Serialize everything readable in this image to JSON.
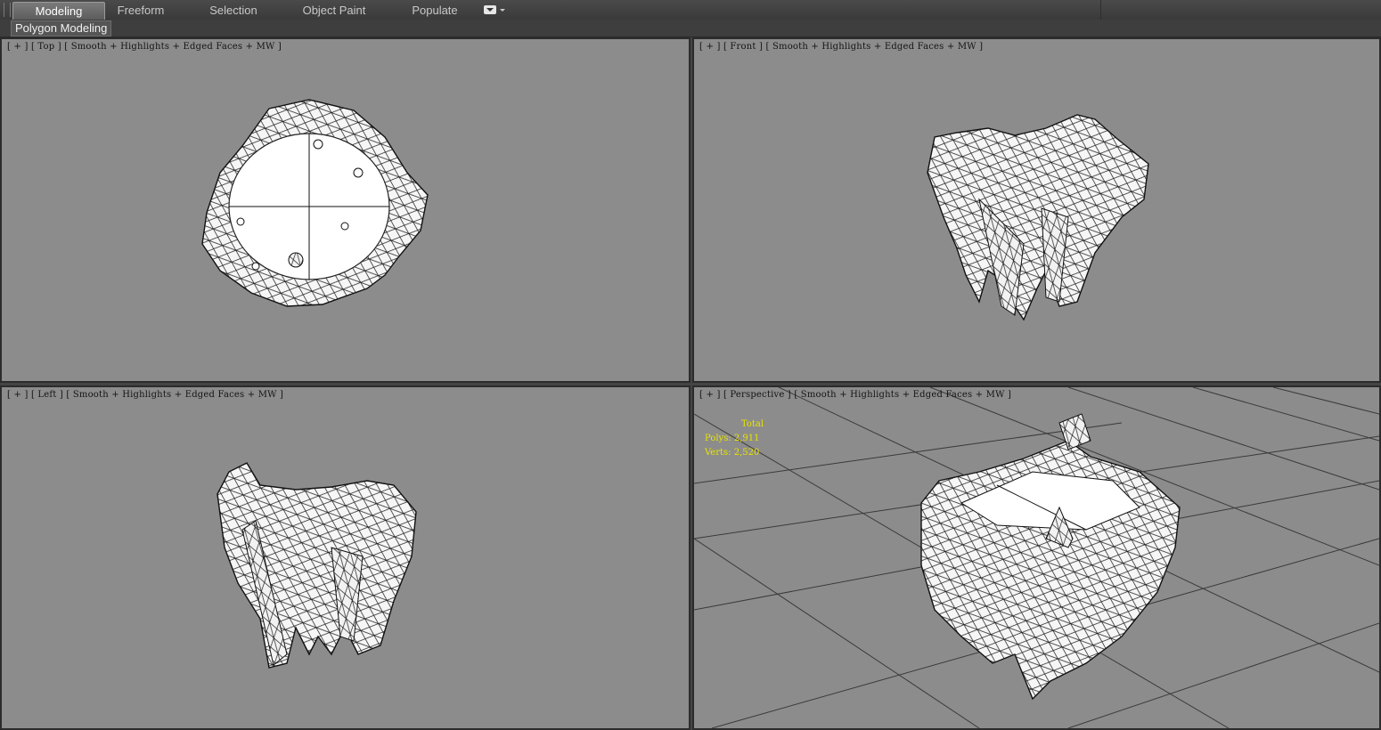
{
  "ribbon": {
    "tabs": [
      {
        "label": "Modeling",
        "active": true
      },
      {
        "label": "Freeform",
        "active": false
      },
      {
        "label": "Selection",
        "active": false
      },
      {
        "label": "Object Paint",
        "active": false
      },
      {
        "label": "Populate",
        "active": false
      }
    ],
    "panel_label": "Polygon Modeling"
  },
  "viewports": {
    "top": {
      "plus": "[ + ]",
      "name": "[ Top ]",
      "shading": "[ Smooth + Highlights + Edged Faces + MW ]"
    },
    "front": {
      "plus": "[ + ]",
      "name": "[ Front ]",
      "shading": "[ Smooth + Highlights + Edged Faces + MW ]"
    },
    "left": {
      "plus": "[ + ]",
      "name": "[ Left ]",
      "shading": "[ Smooth + Highlights + Edged Faces + MW ]"
    },
    "perspective": {
      "plus": "[ + ]",
      "name": "[ Perspective ]",
      "shading": "[ Smooth + Highlights + Edged Faces + MW ]"
    }
  },
  "stats": {
    "title": "Total",
    "polys": "Polys: 2,911",
    "verts": "Verts: 2,520"
  },
  "colors": {
    "viewport_bg": "#8c8c8c",
    "stats_text": "#e8e400",
    "active_tab": "#6b6b6b"
  },
  "icons": [
    "ribbon-grip-icon",
    "panel-dropdown-icon"
  ]
}
